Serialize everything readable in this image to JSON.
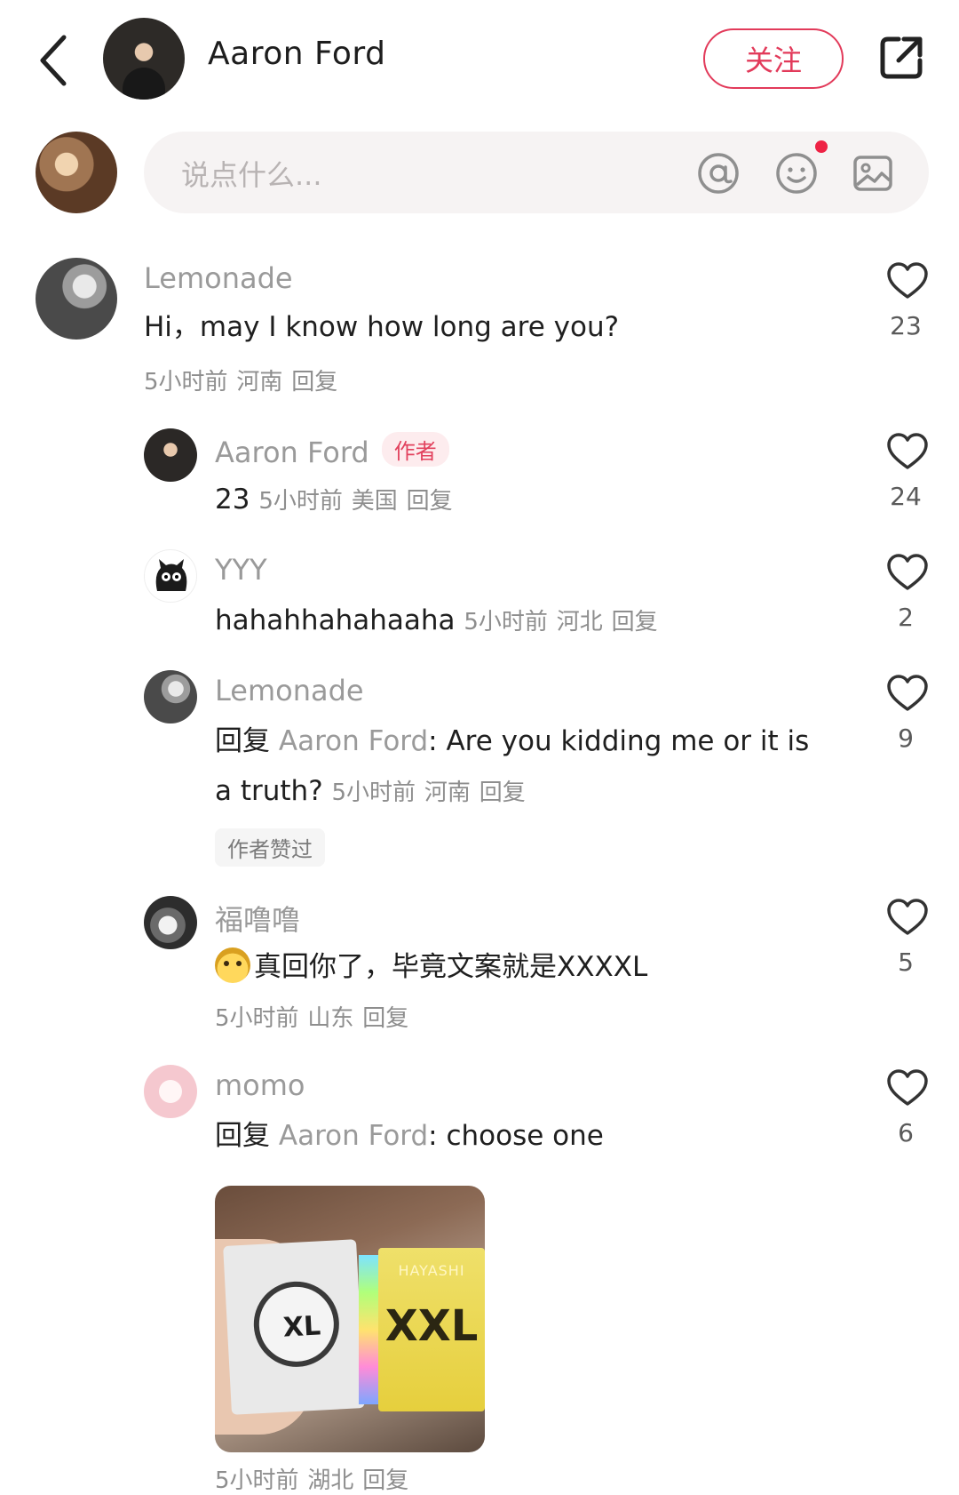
{
  "header": {
    "name": "Aaron Ford",
    "follow_label": "关注",
    "back_icon": "chevron-left-icon",
    "share_icon": "share-icon"
  },
  "input": {
    "placeholder": "说点什么...",
    "icons": [
      "at-icon",
      "emoji-icon",
      "image-icon"
    ]
  },
  "comments": [
    {
      "username": "Lemonade",
      "text": "Hi，may I know how long are you?",
      "time": "5小时前",
      "location": "河南",
      "reply": "回复",
      "likes": "23",
      "replies": [
        {
          "username": "Aaron Ford",
          "badge": "作者",
          "text": "23",
          "time": "5小时前",
          "location": "美国",
          "reply": "回复",
          "likes": "24"
        },
        {
          "username": "YYY",
          "text": "hahahhahahaaha",
          "time": "5小时前",
          "location": "河北",
          "reply": "回复",
          "likes": "2"
        },
        {
          "username": "Lemonade",
          "reply_prefix": "回复",
          "mention": "Aaron Ford",
          "text_line1": ": Are you kidding me or it is",
          "text_line2": "a truth?",
          "time": "5小时前",
          "location": "河南",
          "reply": "回复",
          "likes": "9",
          "liked_by_author": "作者赞过"
        },
        {
          "username": "福噜噜",
          "text": "真回你了，毕竟文案就是XXXXL",
          "time": "5小时前",
          "location": "山东",
          "reply": "回复",
          "likes": "5"
        },
        {
          "username": "momo",
          "reply_prefix": "回复",
          "mention": "Aaron Ford",
          "text": ": choose one",
          "time": "5小时前",
          "location": "湖北",
          "reply": "回复",
          "likes": "6",
          "image": {
            "box1_label": "XL",
            "box2_brand": "HAYASHI",
            "box2_label": "XXL"
          }
        }
      ]
    }
  ],
  "colors": {
    "accent": "#e23a5a",
    "muted": "#9a9a9a",
    "badge_bg": "#fdecee"
  }
}
